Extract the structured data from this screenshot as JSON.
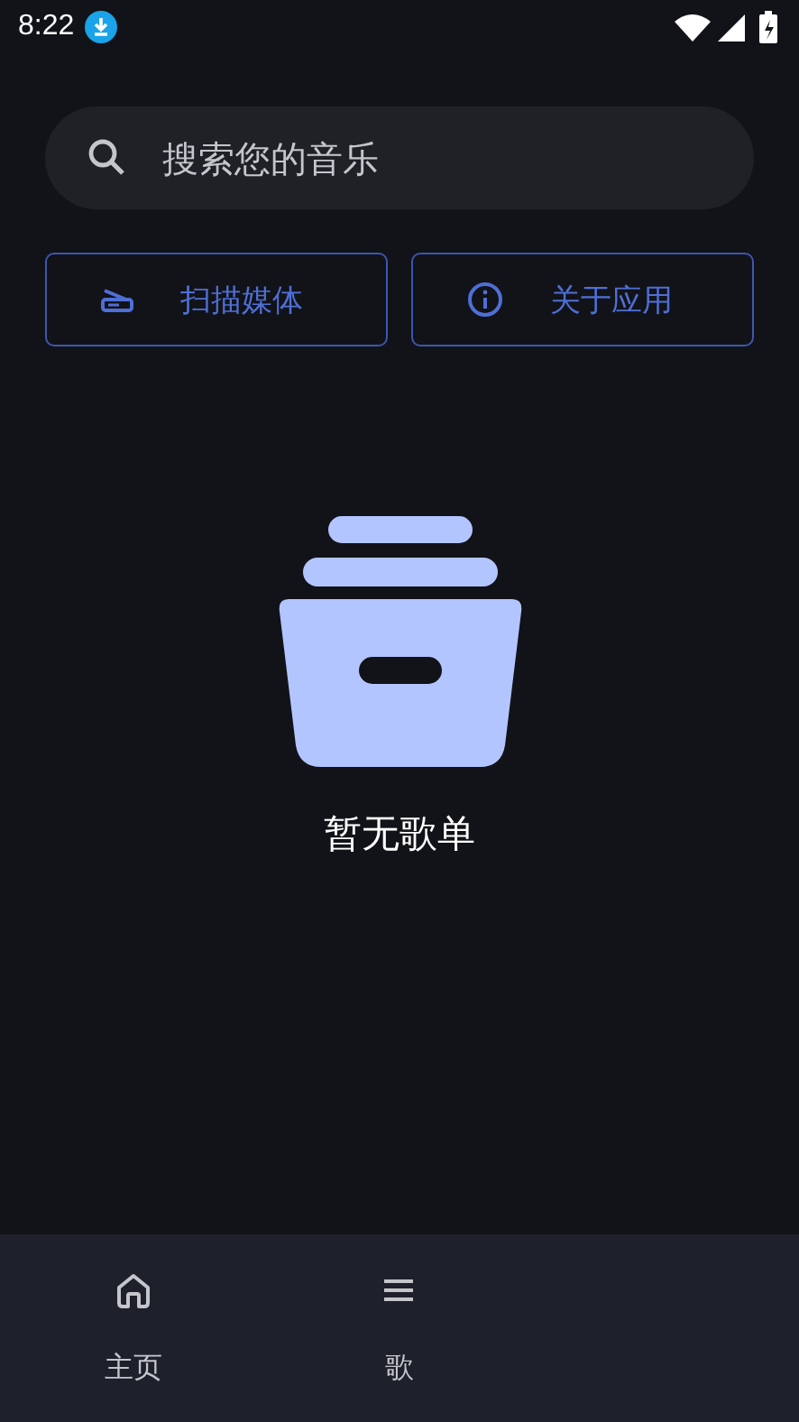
{
  "status_bar": {
    "time": "8:22"
  },
  "search": {
    "placeholder": "搜索您的音乐"
  },
  "actions": [
    {
      "kind": "scan",
      "label": "扫描媒体"
    },
    {
      "kind": "info",
      "label": "关于应用"
    }
  ],
  "empty_state": {
    "message": "暂无歌单"
  },
  "bottom_nav": [
    {
      "kind": "home",
      "label": "主页"
    },
    {
      "kind": "list",
      "label": "歌"
    }
  ]
}
